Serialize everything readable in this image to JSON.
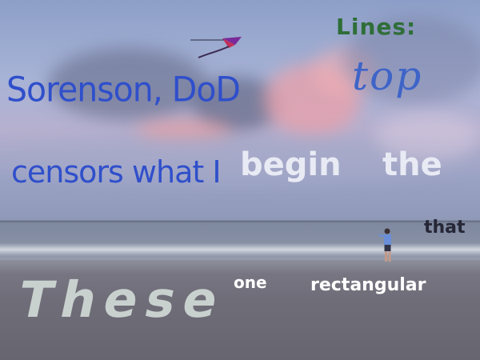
{
  "photo": {
    "description_tags": [
      "sky-background",
      "ocean",
      "beach",
      "kite",
      "kite-flyer"
    ]
  },
  "overlay_text": {
    "lines_label": "Lines:",
    "top_word": "top",
    "sorenson_line": "Sorenson, DoD",
    "censors_line": "censors what I",
    "begin_word": "begin",
    "the_word": "the",
    "that_word": "that",
    "these_word": "These",
    "one_word": "one",
    "rectangular_word": "rectangular"
  },
  "colors": {
    "blue_text": "#2f4fcb",
    "green_text": "#2f6e38",
    "white_text": "#e8eaf4",
    "dark_text": "#252636"
  }
}
